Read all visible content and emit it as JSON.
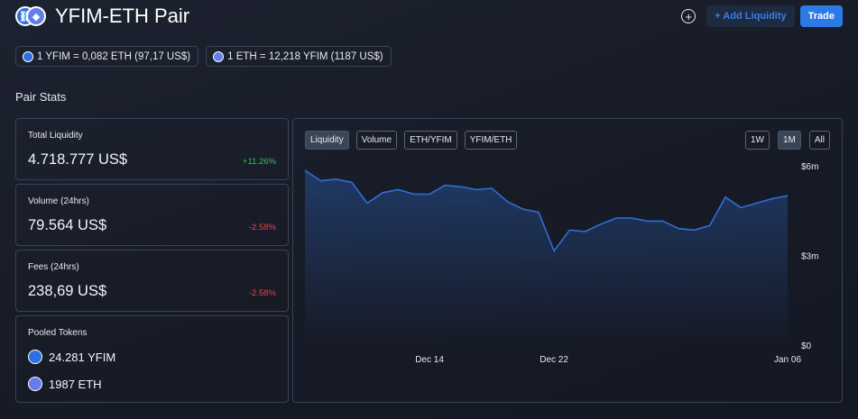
{
  "header": {
    "title": "YFIM-ETH Pair",
    "add_liquidity_label": "+ Add Liquidity",
    "trade_label": "Trade",
    "icons": [
      "yfim-token-icon",
      "eth-token-icon",
      "plus-circle-icon"
    ]
  },
  "rates": [
    {
      "text": "1 YFIM = 0,082 ETH (97,17 US$)",
      "icon": "yfim-token-icon"
    },
    {
      "text": "1 ETH = 12,218 YFIM (1187 US$)",
      "icon": "eth-token-icon"
    }
  ],
  "pair_stats": {
    "title": "Pair Stats",
    "total_liquidity": {
      "label": "Total Liquidity",
      "value": "4.718.777 US$",
      "change": "+11.26%"
    },
    "volume": {
      "label": "Volume (24hrs)",
      "value": "79.564 US$",
      "change": "-2.58%"
    },
    "fees": {
      "label": "Fees (24hrs)",
      "value": "238,69 US$",
      "change": "-2.58%"
    },
    "pooled_tokens": {
      "label": "Pooled Tokens",
      "yfim": "24.281 YFIM",
      "eth": "1987 ETH"
    }
  },
  "chart_tabs": [
    "Liquidity",
    "Volume",
    "ETH/YFIM",
    "YFIM/ETH"
  ],
  "active_chart_tab": "Liquidity",
  "range_tabs": [
    "1W",
    "1M",
    "All"
  ],
  "active_range_tab": "1M",
  "colors": {
    "accent": "#2d7ae6",
    "positive": "#3dbb5c",
    "negative": "#e8434a",
    "line": "#2f6fd6"
  },
  "chart_data": {
    "type": "area",
    "title": "",
    "xlabel": "",
    "ylabel": "",
    "x_tick_labels": [
      "Dec 14",
      "Dec 22",
      "Jan 06"
    ],
    "y_tick_labels": [
      "$6m",
      "$3m",
      "$0"
    ],
    "y_ticks": [
      6,
      3,
      0
    ],
    "ylim": [
      0,
      6
    ],
    "y_unit": "millions USD",
    "series": [
      {
        "values": [
          {
            "x": "Dec 06",
            "y": 5.85
          },
          {
            "x": "Dec 07",
            "y": 5.5
          },
          {
            "x": "Dec 08",
            "y": 5.55
          },
          {
            "x": "Dec 09",
            "y": 5.45
          },
          {
            "x": "Dec 10",
            "y": 4.75
          },
          {
            "x": "Dec 11",
            "y": 5.1
          },
          {
            "x": "Dec 12",
            "y": 5.2
          },
          {
            "x": "Dec 13",
            "y": 5.05
          },
          {
            "x": "Dec 14",
            "y": 5.05
          },
          {
            "x": "Dec 15",
            "y": 5.35
          },
          {
            "x": "Dec 16",
            "y": 5.3
          },
          {
            "x": "Dec 17",
            "y": 5.2
          },
          {
            "x": "Dec 18",
            "y": 5.25
          },
          {
            "x": "Dec 19",
            "y": 4.8
          },
          {
            "x": "Dec 20",
            "y": 4.55
          },
          {
            "x": "Dec 21",
            "y": 4.45
          },
          {
            "x": "Dec 22",
            "y": 3.15
          },
          {
            "x": "Dec 23",
            "y": 3.85
          },
          {
            "x": "Dec 24",
            "y": 3.8
          },
          {
            "x": "Dec 25",
            "y": 4.05
          },
          {
            "x": "Dec 26",
            "y": 4.25
          },
          {
            "x": "Dec 27",
            "y": 4.25
          },
          {
            "x": "Dec 28",
            "y": 4.15
          },
          {
            "x": "Dec 29",
            "y": 4.15
          },
          {
            "x": "Dec 30",
            "y": 3.9
          },
          {
            "x": "Dec 31",
            "y": 3.85
          },
          {
            "x": "Jan 01",
            "y": 4.0
          },
          {
            "x": "Jan 02",
            "y": 4.95
          },
          {
            "x": "Jan 03",
            "y": 4.6
          },
          {
            "x": "Jan 04",
            "y": 4.75
          },
          {
            "x": "Jan 05",
            "y": 4.9
          },
          {
            "x": "Jan 06",
            "y": 5.0
          }
        ]
      }
    ],
    "grid": false,
    "y_axis_position": "right"
  }
}
